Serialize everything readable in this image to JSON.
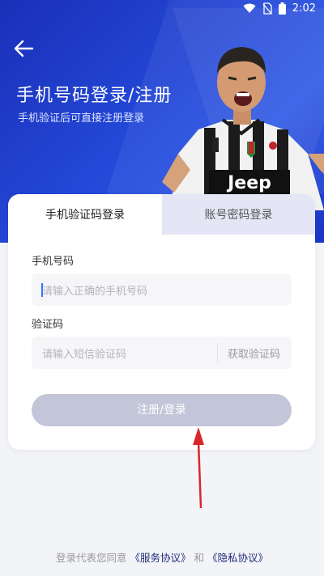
{
  "status_bar": {
    "time": "2:02"
  },
  "header": {
    "title": "手机号码登录/注册",
    "subtitle": "手机验证后可直接注册登录"
  },
  "tabs": [
    {
      "label": "手机验证码登录",
      "active": true
    },
    {
      "label": "账号密码登录",
      "active": false
    }
  ],
  "form": {
    "phone_label": "手机号码",
    "phone_placeholder": "请输入正确的手机号码",
    "code_label": "验证码",
    "code_placeholder": "请输入短信验证码",
    "get_code": "获取验证码",
    "submit": "注册/登录"
  },
  "agreement": {
    "prefix": "登录代表您同意",
    "service": "《服务协议》",
    "and": "和",
    "privacy": "《隐私协议》"
  },
  "colors": {
    "hero": "#2347d6",
    "button": "#c3c6d9",
    "link": "#1f2c7a",
    "annotation_arrow": "#d9262b"
  }
}
